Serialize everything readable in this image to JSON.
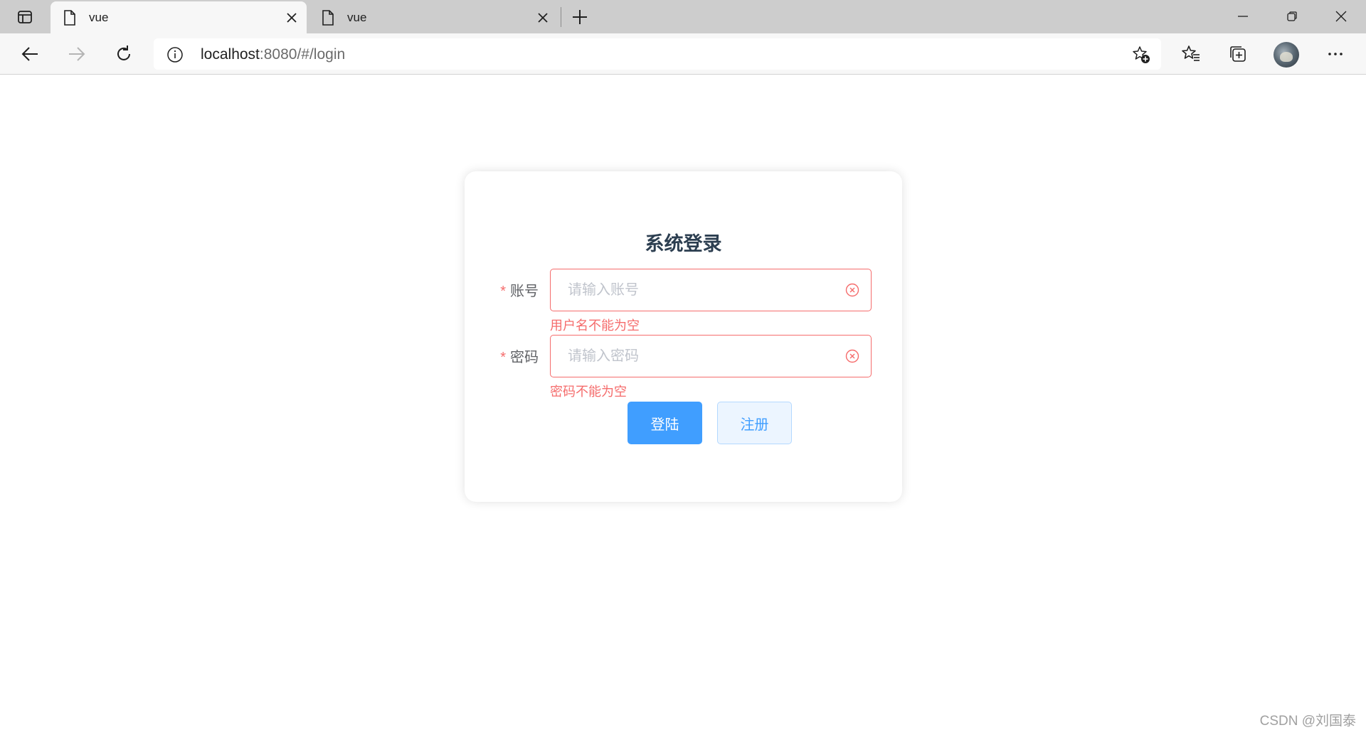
{
  "browser": {
    "tabs": [
      {
        "title": "vue",
        "active": true
      },
      {
        "title": "vue",
        "active": false
      }
    ],
    "address": {
      "host": "localhost",
      "rest": ":8080/#/login"
    }
  },
  "login": {
    "title": "系统登录",
    "required_mark": "*",
    "username": {
      "label": "账号",
      "placeholder": "请输入账号",
      "value": "",
      "error": "用户名不能为空"
    },
    "password": {
      "label": "密码",
      "placeholder": "请输入密码",
      "value": "",
      "error": "密码不能为空"
    },
    "login_button": "登陆",
    "register_button": "注册"
  },
  "watermark": "CSDN @刘国泰",
  "colors": {
    "primary": "#409eff",
    "error": "#f56c6c",
    "title": "#2c3e50"
  },
  "icons": {
    "tab_actions": "tab-actions-icon",
    "document": "document-icon",
    "close": "close-icon",
    "new_tab": "plus-icon",
    "minimize": "minimize-icon",
    "restore": "restore-icon",
    "back": "back-arrow-icon",
    "forward": "forward-arrow-icon",
    "refresh": "refresh-icon",
    "info": "info-icon",
    "add_favorite": "star-plus-icon",
    "favorites": "favorites-icon",
    "collections": "collections-icon",
    "more": "more-icon",
    "clear": "clear-circle-icon"
  }
}
